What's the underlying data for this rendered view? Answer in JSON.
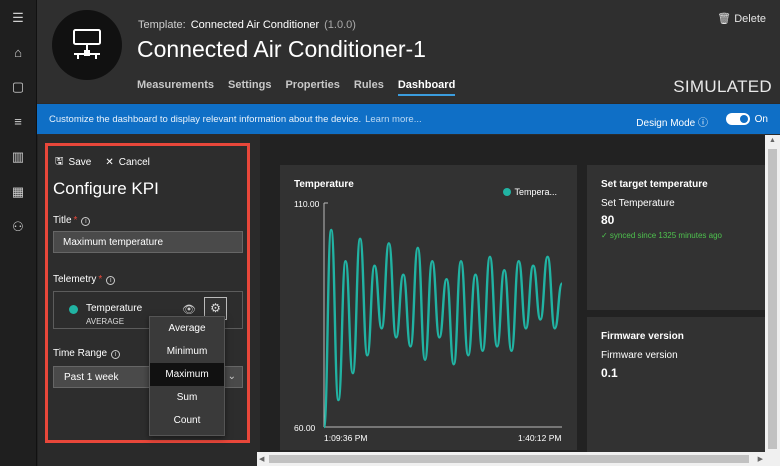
{
  "rail": {
    "icons": [
      "menu-icon",
      "home-icon",
      "devices-icon",
      "list-icon",
      "analytics-icon",
      "dashboard-grid-icon",
      "user-settings-icon"
    ]
  },
  "header": {
    "template_label": "Template:",
    "template_name": "Connected Air Conditioner",
    "template_version": "(1.0.0)",
    "device_title": "Connected Air Conditioner-1",
    "tabs": [
      {
        "label": "Measurements"
      },
      {
        "label": "Settings"
      },
      {
        "label": "Properties"
      },
      {
        "label": "Rules"
      },
      {
        "label": "Dashboard"
      }
    ],
    "active_tab": "Dashboard",
    "status": "SIMULATED",
    "delete_label": "Delete"
  },
  "banner": {
    "text": "Customize the dashboard to display relevant information about the device.",
    "link": "Learn more...",
    "design_mode_label": "Design Mode",
    "toggle_state": "On",
    "color": "#0f6fc6"
  },
  "configure": {
    "save_label": "Save",
    "cancel_label": "Cancel",
    "title": "Configure KPI",
    "title_label": "Title",
    "title_value": "Maximum temperature",
    "telemetry_label": "Telemetry",
    "telemetry_name": "Temperature",
    "telemetry_aggregate": "AVERAGE",
    "time_range_label": "Time Range",
    "time_range_value": "Past 1 week",
    "aggregation_options": [
      "Average",
      "Minimum",
      "Maximum",
      "Sum",
      "Count"
    ],
    "highlighted_option": "Maximum"
  },
  "chart_card": {
    "title": "Temperature",
    "legend": "Tempera...",
    "y_top": "110.00",
    "y_bottom": "60.00",
    "x_start": "1:09:36 PM",
    "x_end": "1:40:12 PM"
  },
  "chart_data": {
    "type": "line",
    "title": "Temperature",
    "ylim": [
      60,
      110
    ],
    "series": [
      {
        "name": "Tempera...",
        "color": "#21b3a3",
        "values": [
          60,
          104,
          66,
          97,
          72,
          102,
          76,
          96,
          82,
          101,
          80,
          94,
          78,
          100,
          75,
          97,
          80,
          93,
          74,
          97,
          76,
          94,
          77,
          98,
          78,
          95,
          77,
          97,
          82,
          96,
          84,
          98,
          82,
          92
        ]
      }
    ],
    "x_tick_labels": [
      "1:09:36 PM",
      "1:40:12 PM"
    ]
  },
  "target_card": {
    "title": "Set target temperature",
    "label": "Set Temperature",
    "value": "80",
    "status": "✓ synced since 1325 minutes ago"
  },
  "firmware_card": {
    "title": "Firmware version",
    "label": "Firmware version",
    "value": "0.1"
  }
}
